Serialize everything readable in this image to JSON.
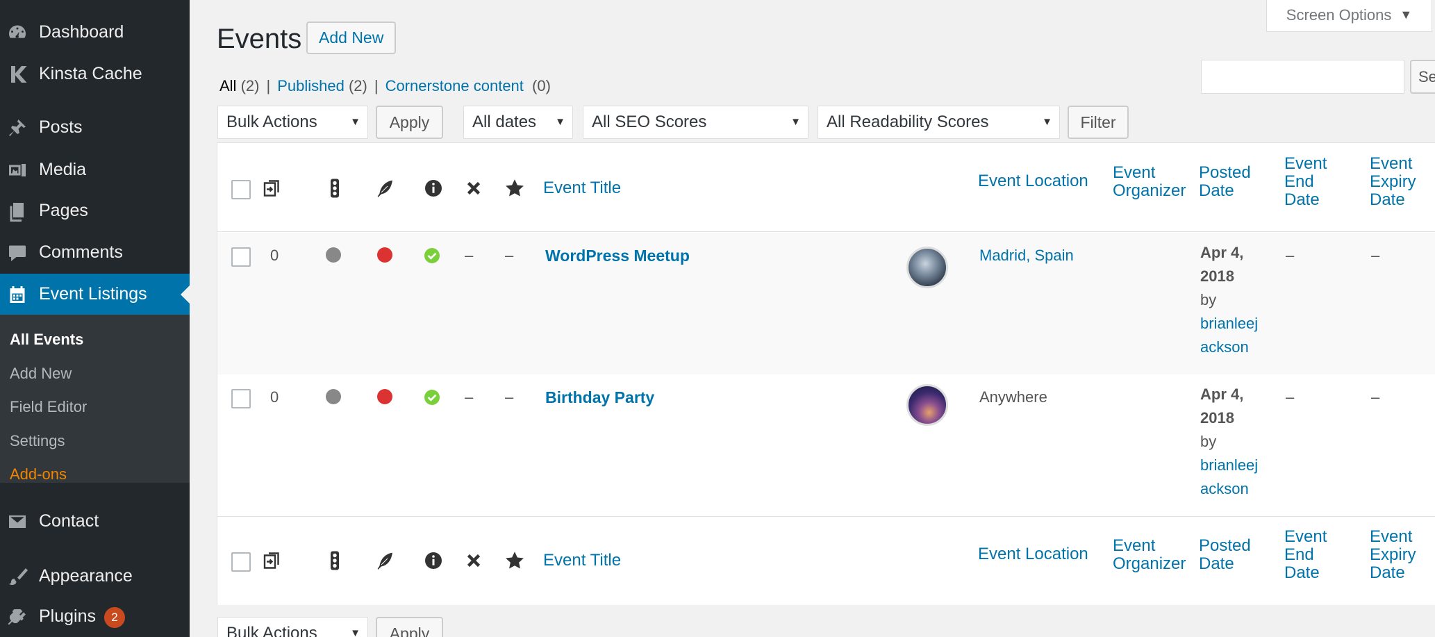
{
  "sidebar": {
    "dashboard": "Dashboard",
    "kinsta": "Kinsta Cache",
    "posts": "Posts",
    "media": "Media",
    "pages": "Pages",
    "comments": "Comments",
    "events": "Event Listings",
    "contact": "Contact",
    "appearance": "Appearance",
    "plugins": "Plugins",
    "plugins_badge": "2",
    "submenu": {
      "all_events": "All Events",
      "add_new": "Add New",
      "field_editor": "Field Editor",
      "settings": "Settings",
      "addons": "Add-ons"
    }
  },
  "header": {
    "title": "Events",
    "add_new": "Add New",
    "screen_options": "Screen Options",
    "search_button": "Se"
  },
  "filters_nav": {
    "all": "All",
    "all_count": "(2)",
    "published": "Published",
    "published_count": "(2)",
    "cornerstone": "Cornerstone content",
    "cornerstone_count": "(0)"
  },
  "toolbar": {
    "bulk_actions": "Bulk Actions",
    "apply": "Apply",
    "dates": "All dates",
    "seo": "All SEO Scores",
    "readability": "All Readability Scores",
    "filter": "Filter"
  },
  "columns": {
    "title": "Event Title",
    "location": "Event Location",
    "organizer": "Event Organizer",
    "posted": "Posted Date",
    "end": "Event End Date",
    "expiry": "Event Expiry Date",
    "organizer_l1": "Event",
    "organizer_l2": "Organizer",
    "posted_l1": "Posted",
    "posted_l2": "Date",
    "end_l1": "Event",
    "end_l2": "End",
    "end_l3": "Date",
    "expiry_l1": "Event",
    "expiry_l2": "Expiry",
    "expiry_l3": "Date"
  },
  "rows": [
    {
      "links_count": "0",
      "seo": "–",
      "readability": "–",
      "title": "WordPress Meetup",
      "location": "Madrid, Spain",
      "date_line1": "Apr 4,",
      "date_line2": "2018",
      "by": "by",
      "author_line1": "brianleej",
      "author_line2": "ackson",
      "end_date": "–",
      "expiry_date": "–"
    },
    {
      "links_count": "0",
      "seo": "–",
      "readability": "–",
      "title": "Birthday Party",
      "location": "Anywhere",
      "date_line1": "Apr 4,",
      "date_line2": "2018",
      "by": "by",
      "author_line1": "brianleej",
      "author_line2": "ackson",
      "end_date": "–",
      "expiry_date": "–"
    }
  ],
  "colors": {
    "sidebar_bg": "#23282d",
    "accent": "#0073aa",
    "addons": "#f18500",
    "badge": "#ca4a1f",
    "status_grey": "#888888",
    "status_red": "#dc3232",
    "status_green": "#7ad03a"
  }
}
